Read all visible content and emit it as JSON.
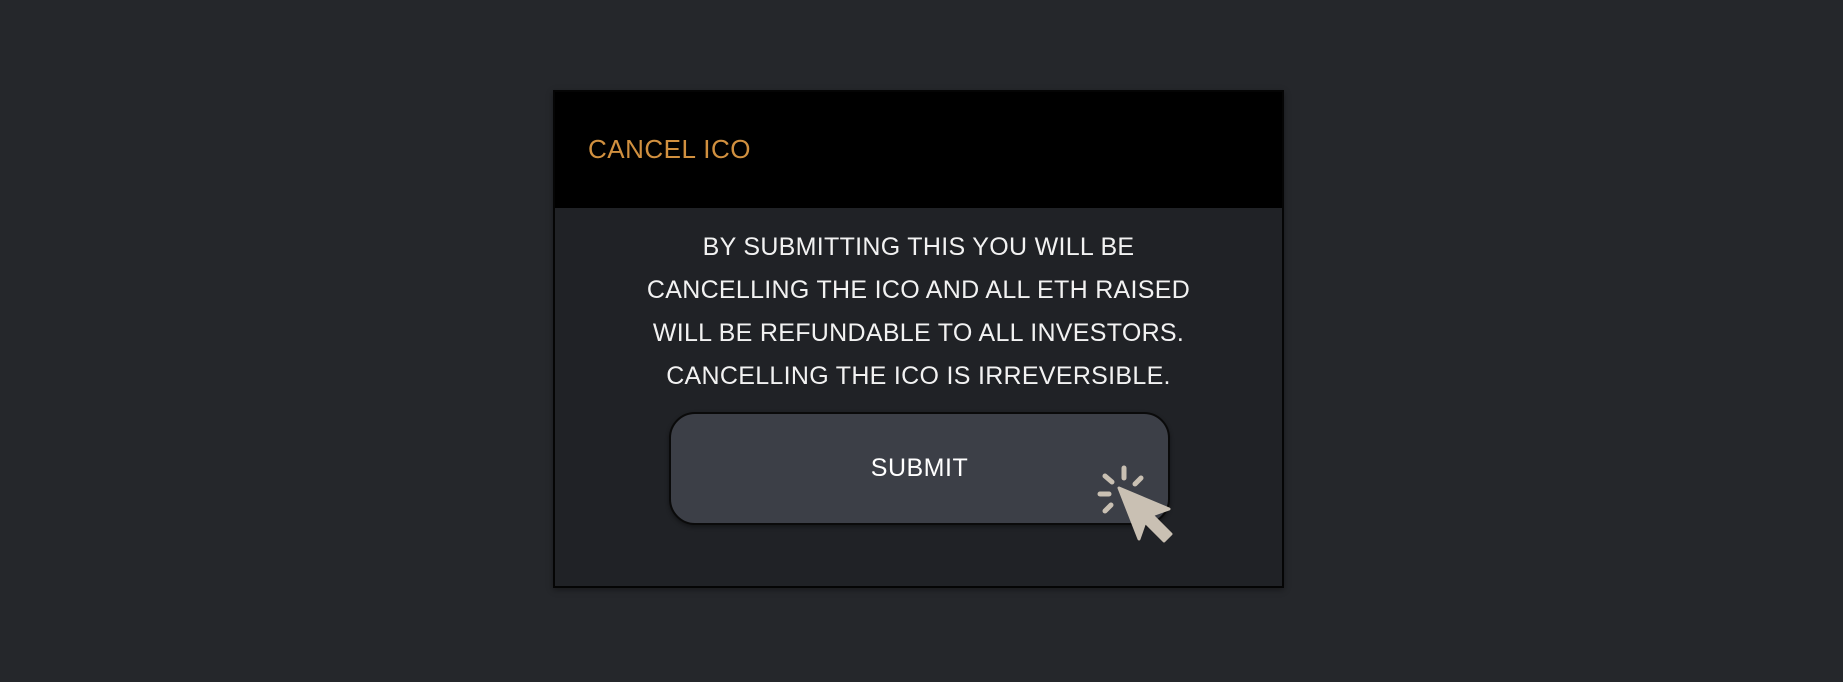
{
  "dialog": {
    "title": "CANCEL ICO",
    "message_lines": [
      "BY SUBMITTING THIS YOU WILL BE",
      "CANCELLING THE ICO AND ALL ETH RAISED",
      "WILL BE REFUNDABLE TO ALL INVESTORS.",
      "CANCELLING THE ICO IS IRREVERSIBLE."
    ],
    "submit_label": "SUBMIT",
    "cursor_icon": "click-pointer-icon"
  },
  "colors": {
    "background": "#25272b",
    "header": "#000000",
    "body": "#202226",
    "title": "#d1903f",
    "button": "#3c3f47",
    "cursor": "#c9c0b3"
  }
}
